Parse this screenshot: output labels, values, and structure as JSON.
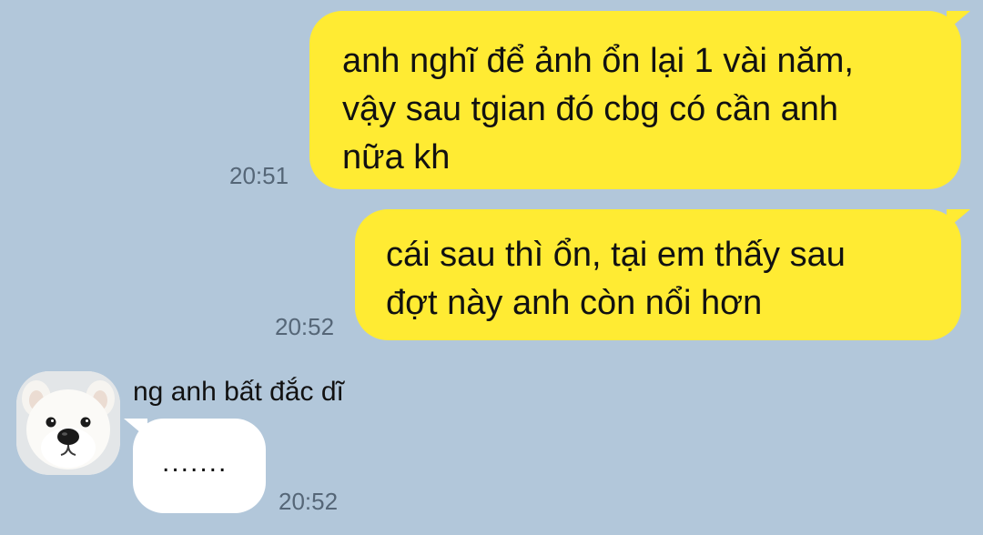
{
  "messages": [
    {
      "direction": "outgoing",
      "text": "anh nghĩ để ảnh ổn lại 1 vài năm,\nvậy sau tgian đó cbg có cần anh\nnữa kh",
      "time": "20:51"
    },
    {
      "direction": "outgoing",
      "text": "cái sau thì ổn, tại em thấy sau\nđợt này anh còn nổi hơn",
      "time": "20:52"
    },
    {
      "direction": "incoming",
      "sender": "ng anh bất đắc dĩ",
      "text": ".......",
      "time": "20:52"
    }
  ],
  "colors": {
    "background": "#b2c7da",
    "outgoing_bubble": "#ffeb33",
    "incoming_bubble": "#ffffff",
    "timestamp": "#556677"
  },
  "icons": {
    "avatar": "samoyed-dog-avatar"
  }
}
